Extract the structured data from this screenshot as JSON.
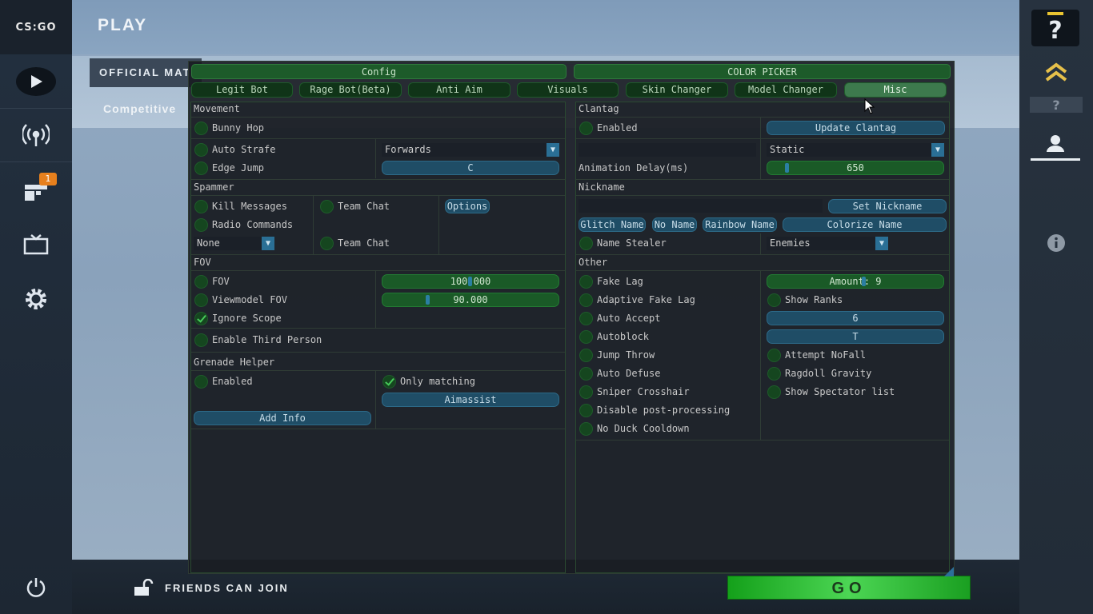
{
  "app": {
    "logo_text": "CS:GO",
    "page_title": "PLAY"
  },
  "sidebar": {
    "notification_count": "1"
  },
  "play": {
    "mode_tab": "OFFICIAL MAT",
    "mode_label": "Competitive",
    "friends_label": "FRIENDS CAN JOIN",
    "go_label": "GO"
  },
  "menu": {
    "headers": {
      "config": "Config",
      "color_picker": "COLOR PICKER"
    },
    "tabs": [
      "Legit Bot",
      "Rage Bot(Beta)",
      "Anti Aim",
      "Visuals",
      "Skin Changer",
      "Model Changer",
      "Misc"
    ],
    "active_tab": "Misc",
    "left": {
      "movement": {
        "title": "Movement",
        "bunny_hop": "Bunny Hop",
        "auto_strafe": "Auto Strafe",
        "edge_jump": "Edge Jump",
        "strafe_dir": "Forwards",
        "edge_key": "C"
      },
      "spammer": {
        "title": "Spammer",
        "kill_messages": "Kill Messages",
        "team_chat": "Team Chat",
        "options": "Options",
        "radio_commands": "Radio Commands",
        "radio_select": "None",
        "team_chat2": "Team Chat"
      },
      "fov": {
        "title": "FOV",
        "fov": "FOV",
        "viewmodel_fov": "Viewmodel FOV",
        "ignore_scope": "Ignore Scope",
        "third_person": "Enable Third Person",
        "fov_value": "100.000",
        "fov_fraction": 0.5,
        "viewmodel_value": "90.000",
        "viewmodel_fraction": 0.25
      },
      "grenade": {
        "title": "Grenade Helper",
        "enabled": "Enabled",
        "only_matching": "Only matching",
        "aimassist": "Aimassist",
        "add_info": "Add Info"
      }
    },
    "right": {
      "clantag": {
        "title": "Clantag",
        "enabled": "Enabled",
        "update": "Update Clantag",
        "mode": "Static",
        "delay_label": "Animation Delay(ms)",
        "delay_value": "650",
        "delay_fraction": 0.1
      },
      "nickname": {
        "title": "Nickname",
        "set": "Set Nickname",
        "glitch": "Glitch Name",
        "no_name": "No Name",
        "rainbow": "Rainbow Name",
        "colorize": "Colorize Name",
        "stealer": "Name Stealer",
        "target": "Enemies"
      },
      "other": {
        "title": "Other",
        "fake_lag": "Fake Lag",
        "adaptive": "Adaptive Fake Lag",
        "auto_accept": "Auto Accept",
        "autoblock": "Autoblock",
        "jump_throw": "Jump Throw",
        "auto_defuse": "Auto Defuse",
        "sniper_crosshair": "Sniper Crosshair",
        "disable_pp": "Disable post-processing",
        "no_duck": "No Duck Cooldown",
        "amount": "Amount: 9",
        "amount_fraction": 0.55,
        "show_ranks": "Show Ranks",
        "key_six": "6",
        "key_t": "T",
        "nofall": "Attempt NoFall",
        "ragdoll": "Ragdoll Gravity",
        "spectators": "Show Spectator list"
      }
    }
  }
}
